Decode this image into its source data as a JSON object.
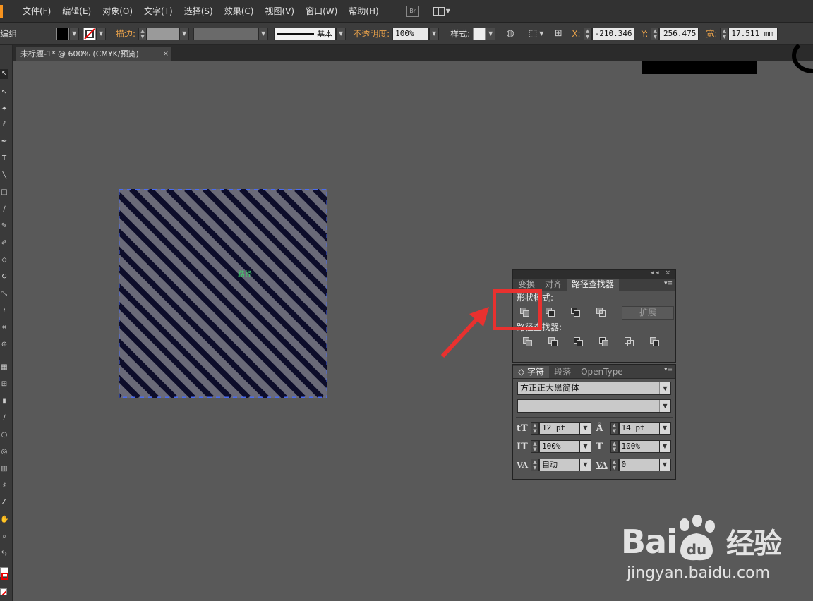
{
  "menu": {
    "items": [
      "文件(F)",
      "编辑(E)",
      "对象(O)",
      "文字(T)",
      "选择(S)",
      "效果(C)",
      "视图(V)",
      "窗口(W)",
      "帮助(H)"
    ],
    "bridge_badge": "Br"
  },
  "control": {
    "group_label": "编组",
    "stroke_label": "描边:",
    "stroke_style_label": "基本",
    "opacity_label": "不透明度:",
    "opacity_value": "100%",
    "style_label": "样式:",
    "x_label": "X:",
    "x_value": "-210.346",
    "y_label": "Y:",
    "y_value": "256.475",
    "width_label": "宽:",
    "width_value": "17.511 mm"
  },
  "document": {
    "tab_title": "未标题-1* @ 600% (CMYK/预览)",
    "close_glyph": "×"
  },
  "canvas": {
    "path_hint": "路径"
  },
  "pathfinder_panel": {
    "tabs": [
      "变换",
      "对齐",
      "路径查找器"
    ],
    "active_tab": 2,
    "shape_modes_label": "形状模式:",
    "expand_label": "扩展",
    "pathfinders_label": "路径查找器:"
  },
  "character_panel": {
    "tabs": [
      "字符",
      "段落",
      "OpenType"
    ],
    "font_family": "方正正大黑简体",
    "font_style": "-",
    "font_size": "12 pt",
    "leading": "14 pt",
    "vertical_scale": "100%",
    "horizontal_scale": "100%",
    "kerning": "自动",
    "tracking": "0"
  },
  "watermark": {
    "logo_text": "Bai",
    "logo_text_2": "经验",
    "logo_du": "du",
    "url": "jingyan.baidu.com"
  },
  "colors": {
    "highlight": "#e8312f",
    "selection": "#4a6cf0",
    "stripe": "#0d0d2a"
  }
}
